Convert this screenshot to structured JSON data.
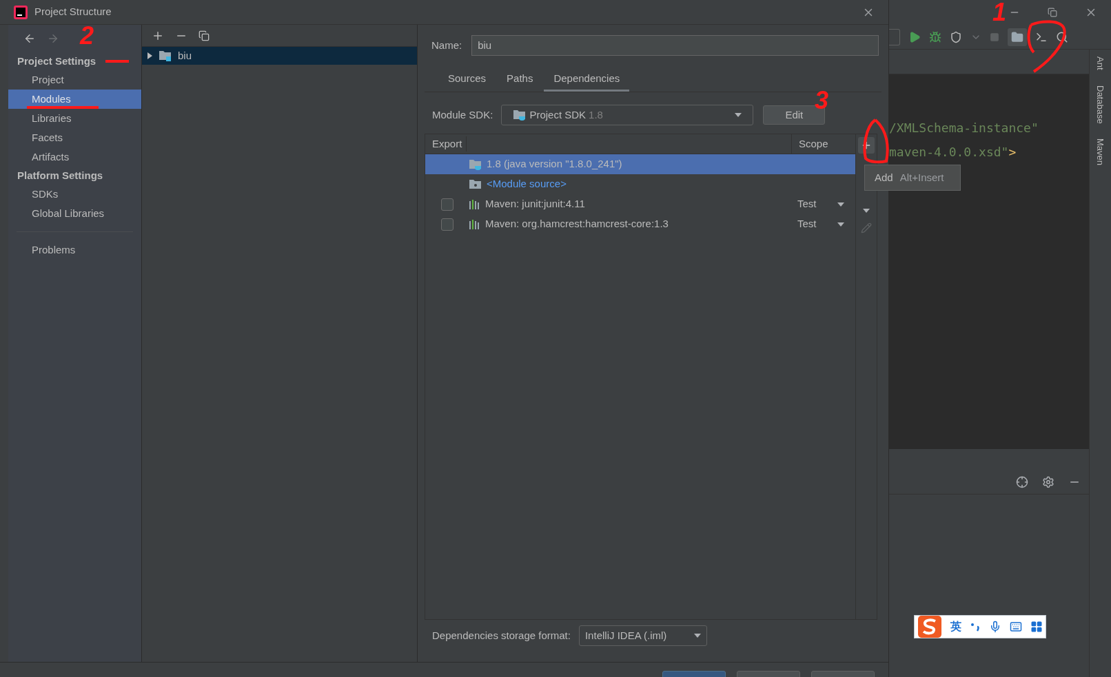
{
  "dialog": {
    "title": "Project Structure"
  },
  "sidebar": {
    "sections": [
      {
        "heading": "Project Settings",
        "items": [
          {
            "label": "Project",
            "selected": false
          },
          {
            "label": "Modules",
            "selected": true
          },
          {
            "label": "Libraries",
            "selected": false
          },
          {
            "label": "Facets",
            "selected": false
          },
          {
            "label": "Artifacts",
            "selected": false
          }
        ]
      },
      {
        "heading": "Platform Settings",
        "items": [
          {
            "label": "SDKs",
            "selected": false
          },
          {
            "label": "Global Libraries",
            "selected": false
          }
        ]
      }
    ],
    "footer_items": [
      {
        "label": "Problems",
        "selected": false
      }
    ]
  },
  "tree": {
    "items": [
      {
        "label": "biu",
        "expanded": false,
        "selected": true
      }
    ]
  },
  "module": {
    "name_label": "Name:",
    "name": "biu",
    "tabs": [
      {
        "label": "Sources",
        "selected": false
      },
      {
        "label": "Paths",
        "selected": false
      },
      {
        "label": "Dependencies",
        "selected": true
      }
    ],
    "sdk_label": "Module SDK:",
    "sdk_value": "Project SDK",
    "sdk_version": "1.8",
    "edit_button": "Edit",
    "table": {
      "columns": [
        "Export",
        "Scope"
      ],
      "rows": [
        {
          "kind": "sdk",
          "name": "1.8 (java version \"1.8.0_241\")",
          "selected": true
        },
        {
          "kind": "source",
          "name": "<Module source>",
          "selected": false
        },
        {
          "kind": "library",
          "exported": false,
          "name": "Maven: junit:junit:4.11",
          "scope": "Test",
          "selected": false
        },
        {
          "kind": "library",
          "exported": false,
          "name": "Maven: org.hamcrest:hamcrest-core:1.3",
          "scope": "Test",
          "selected": false
        }
      ]
    },
    "tooltip": {
      "label": "Add",
      "shortcut": "Alt+Insert"
    },
    "storage_label": "Dependencies storage format:",
    "storage_value": "IntelliJ IDEA (.iml)"
  },
  "ide": {
    "code_lines": [
      [
        {
          "kind": "string",
          "text": "/XMLSchema-instance\""
        }
      ],
      [
        {
          "kind": "string",
          "text": "maven-4.0.0.xsd\""
        },
        {
          "kind": "tag",
          "text": ">"
        }
      ]
    ],
    "side_tools": [
      "Ant",
      "Database",
      "Maven"
    ]
  },
  "ime": {
    "mode": "英"
  },
  "annotations": [
    "1",
    "2",
    "3"
  ]
}
